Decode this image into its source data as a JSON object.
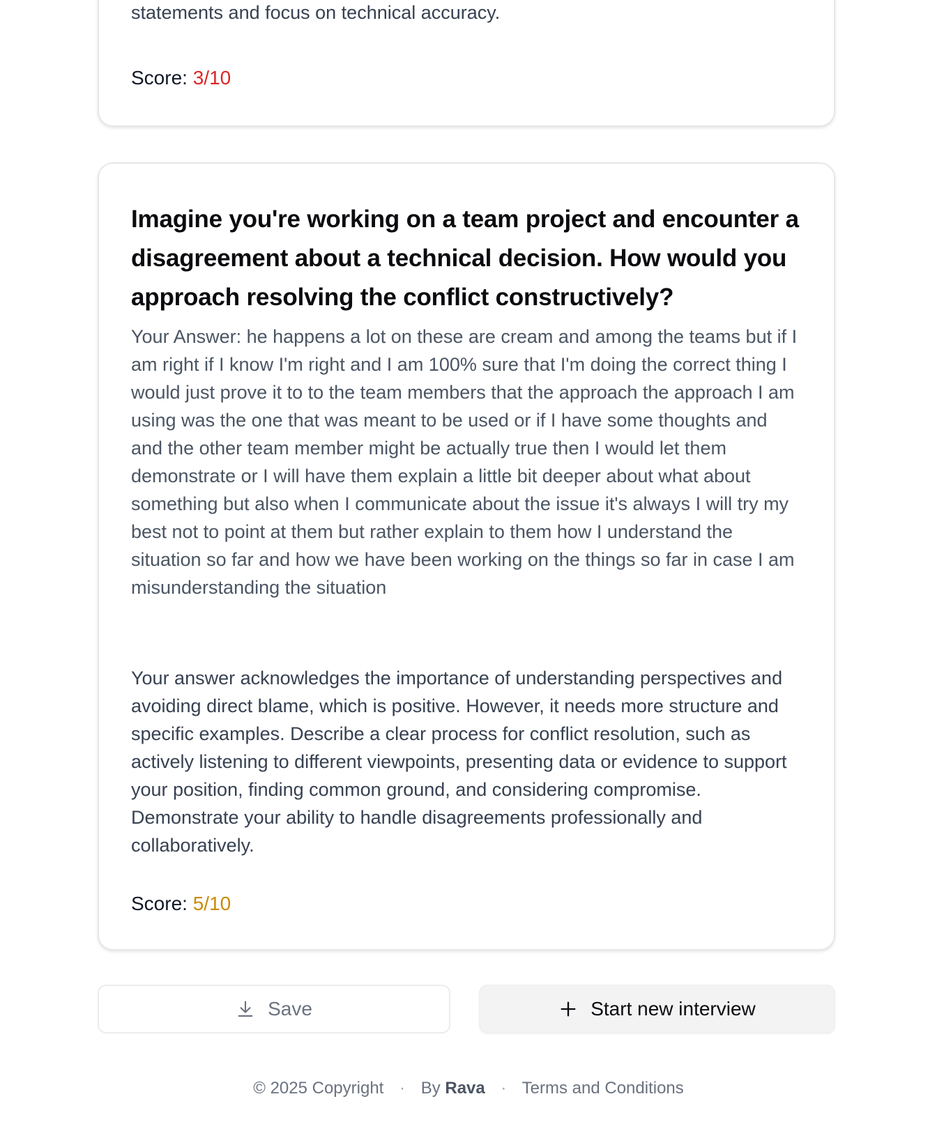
{
  "previous_card": {
    "feedback_tail": "dataset and search scenario, providing a clear rationale. Avoid vague statements and focus on technical accuracy.",
    "score_label": "Score:",
    "score_value": "3/10"
  },
  "current_card": {
    "question": "Imagine you're working on a team project and encounter a disagreement about a technical decision. How would you approach resolving the conflict constructively?",
    "answer": "Your Answer: he happens a lot on these are cream and among the teams but if I am right if I know I'm right and I am 100% sure that I'm doing the correct thing I would just prove it to to the team members that the approach the approach I am using was the one that was meant to be used or if I have some thoughts and and the other team member might be actually true then I would let them demonstrate or I will have them explain a little bit deeper about what about something but also when I communicate about the issue it's always I will try my best not to point at them but rather explain to them how I understand the situation so far and how we have been working on the things so far in case I am misunderstanding the situation",
    "feedback": "Your answer acknowledges the importance of understanding perspectives and avoiding direct blame, which is positive. However, it needs more structure and specific examples. Describe a clear process for conflict resolution, such as actively listening to different viewpoints, presenting data or evidence to support your position, finding common ground, and considering compromise. Demonstrate your ability to handle disagreements professionally and collaboratively.",
    "score_label": "Score:",
    "score_value": "5/10"
  },
  "actions": {
    "save_label": "Save",
    "save_icon": "download-icon",
    "new_interview_label": "Start new interview",
    "new_interview_icon": "plus-icon"
  },
  "footer": {
    "copyright": "© 2025 Copyright",
    "separator": "·",
    "by_prefix": "By",
    "brand": "Rava",
    "terms": "Terms and Conditions"
  },
  "colors": {
    "score_low": "#dc2626",
    "score_mid": "#ca8a04"
  }
}
